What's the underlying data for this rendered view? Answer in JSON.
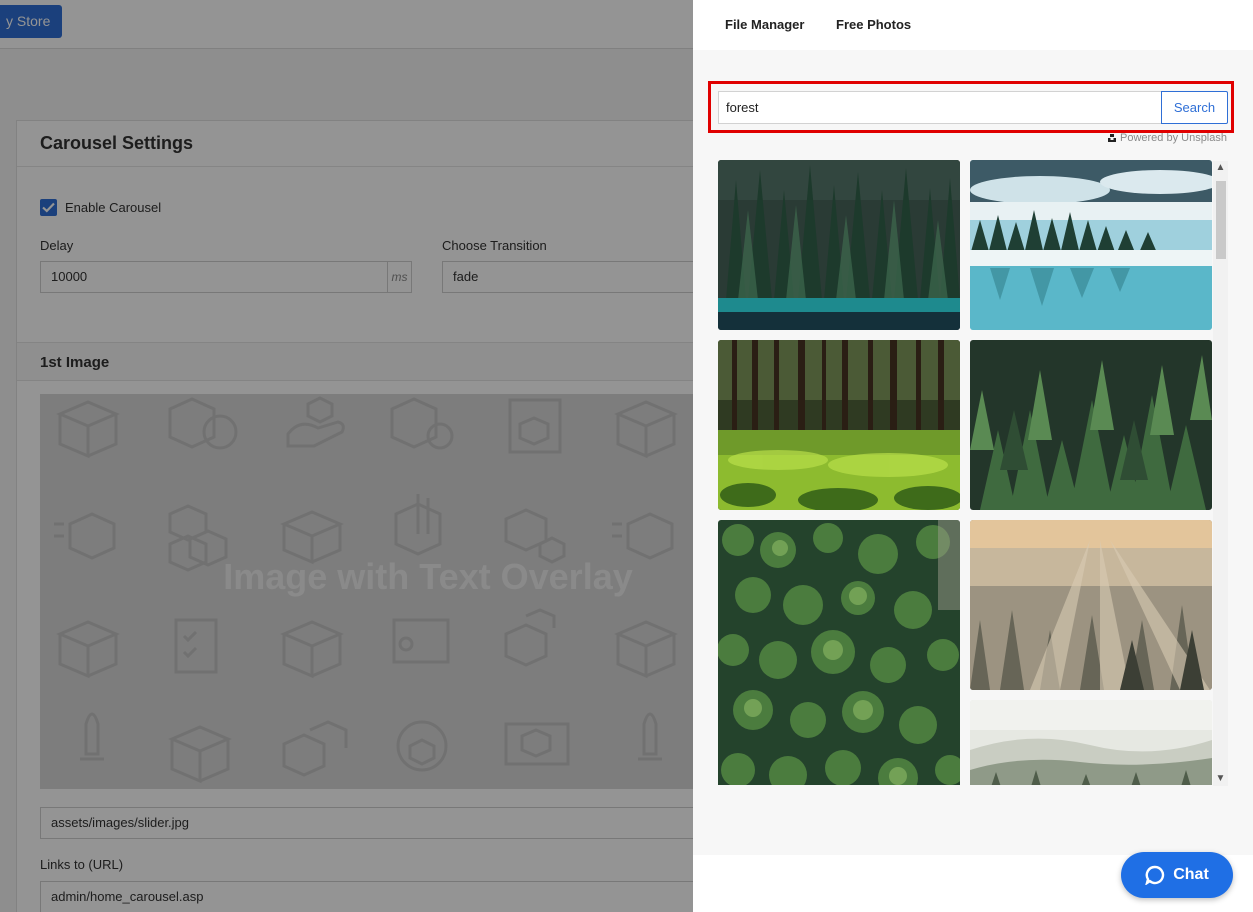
{
  "topbar": {
    "store_button_label": "y Store"
  },
  "carousel": {
    "title": "Carousel Settings",
    "enable_label": "Enable Carousel",
    "enabled": true,
    "delay_label": "Delay",
    "delay_value": "10000",
    "delay_suffix": "ms",
    "transition_label": "Choose Transition",
    "transition_value": "fade"
  },
  "first_image": {
    "section_title": "1st Image",
    "overlay_text": "Image with Text Overlay",
    "path_value": "assets/images/slider.jpg",
    "link_label": "Links to (URL)",
    "link_value": "admin/home_carousel.asp"
  },
  "panel": {
    "tabs": [
      {
        "label": "File Manager"
      },
      {
        "label": "Free Photos"
      }
    ],
    "search": {
      "value": "forest",
      "button_label": "Search"
    },
    "powered_by": "Powered by Unsplash",
    "photos": [
      {
        "subject": "dense dark forest above teal lake"
      },
      {
        "subject": "misty lake with forest reflection"
      },
      {
        "subject": "sunlit pine forest with green grass"
      },
      {
        "subject": "dark green fir treetops"
      },
      {
        "subject": "aerial view of forest canopy"
      },
      {
        "subject": "foggy forest at sunrise"
      },
      {
        "subject": "misty hills covered with trees"
      }
    ]
  },
  "chat": {
    "label": "Chat"
  },
  "colors": {
    "accent": "#2f6fd6",
    "highlight_border": "#e00000",
    "chat": "#1f6fe5"
  }
}
